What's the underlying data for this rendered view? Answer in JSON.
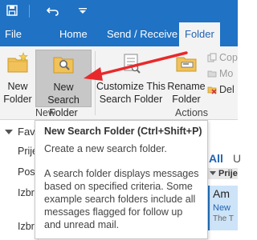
{
  "colors": {
    "accent": "#1f72c4",
    "ribbon_bg": "#f3f3f3",
    "hover_button": "#c7c7c7",
    "annotation_arrow": "#e8292b",
    "selected_row": "#cde3f7"
  },
  "titlebar": {
    "icons": [
      "save-icon",
      "undo-icon",
      "customize-qat-icon"
    ]
  },
  "tabs": [
    {
      "label": "File"
    },
    {
      "label": "Home"
    },
    {
      "label": "Send / Receive"
    },
    {
      "label": "Folder",
      "active": true
    }
  ],
  "ribbon": {
    "buttons": [
      {
        "label_line1": "New",
        "label_line2": "Folder",
        "icon": "new-folder-icon"
      },
      {
        "label_line1": "New Search",
        "label_line2": "Folder",
        "icon": "search-folder-icon",
        "hovered": true
      },
      {
        "label_line1": "Customize This",
        "label_line2": "Search Folder",
        "icon": "customize-search-folder-icon"
      },
      {
        "label_line1": "Rename",
        "label_line2": "Folder",
        "icon": "rename-folder-icon"
      }
    ],
    "small_commands": [
      {
        "label": "Cop",
        "icon": "copy-folder-icon"
      },
      {
        "label": "Mo",
        "icon": "move-folder-icon"
      },
      {
        "label": "Del",
        "icon": "delete-folder-icon"
      }
    ],
    "groups": [
      {
        "label": "New"
      },
      {
        "label": "Actions"
      }
    ]
  },
  "navpane": {
    "favorites": "Fave",
    "items": [
      {
        "label": "Prije"
      },
      {
        "label": "Posla"
      },
      {
        "label": "Izbri"
      },
      {
        "label": "Izbri"
      }
    ]
  },
  "messagelist": {
    "filter_all": "All",
    "filter_unread": "U",
    "group_header": "Prije",
    "selected_item": {
      "sender": "Am",
      "line2": "New",
      "line3": "The T"
    }
  },
  "tooltip": {
    "title": "New Search Folder (Ctrl+Shift+P)",
    "line1": "Create a new search folder.",
    "body": "A search folder displays messages based on specified criteria. Some example search folders include all messages flagged for follow up and unread mail."
  }
}
